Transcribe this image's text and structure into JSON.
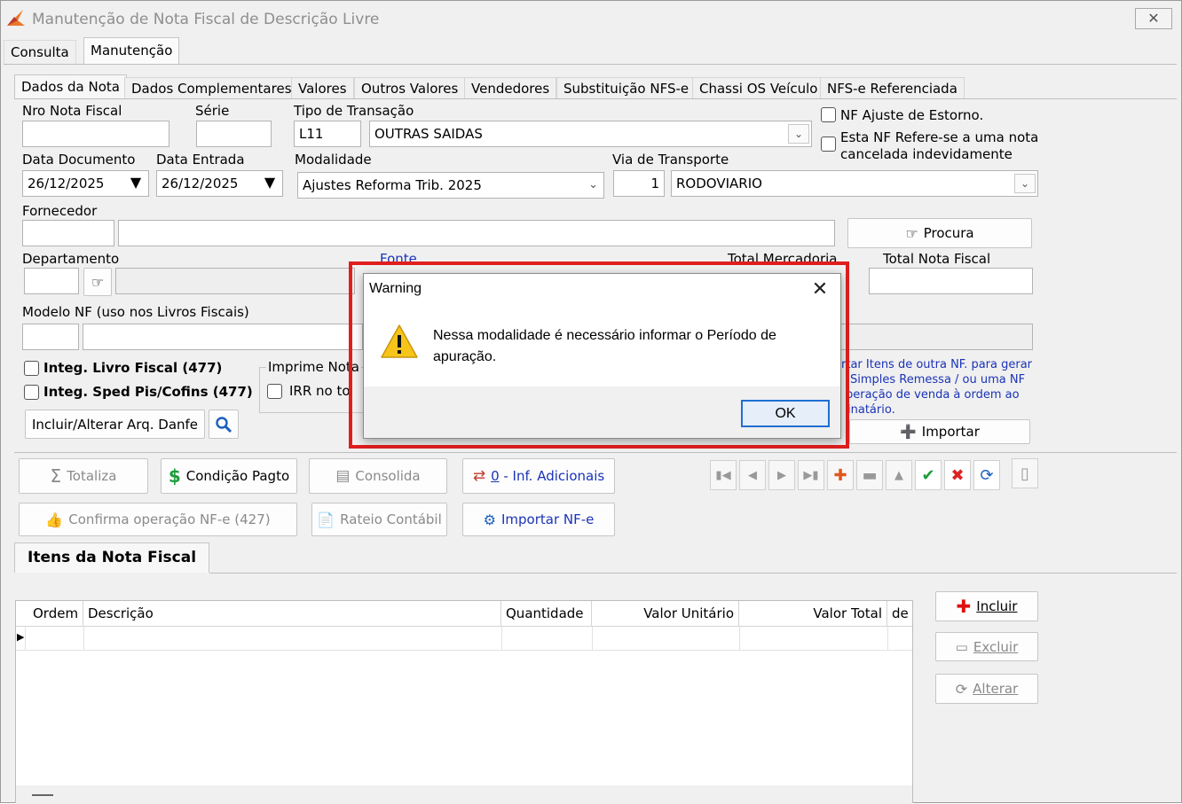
{
  "window": {
    "title": "Manutenção de Nota Fiscal de Descrição Livre",
    "close_glyph": "✕"
  },
  "main_tabs": [
    {
      "label": "Consulta"
    },
    {
      "label": "Manutenção"
    }
  ],
  "sub_tabs": [
    {
      "label": "Dados da Nota"
    },
    {
      "label": "Dados Complementares"
    },
    {
      "label": "Valores"
    },
    {
      "label": "Outros Valores"
    },
    {
      "label": "Vendedores"
    },
    {
      "label": "Substituição NFS-e"
    },
    {
      "label": "Chassi OS Veículo"
    },
    {
      "label": "NFS-e Referenciada"
    }
  ],
  "form": {
    "nro_nota_label": "Nro Nota Fiscal",
    "nro_nota_value": "",
    "serie_label": "Série",
    "serie_value": "",
    "tipo_transacao_label": "Tipo de Transação",
    "tipo_transacao_code": "L11",
    "tipo_transacao_value": "OUTRAS SAIDAS",
    "nf_ajuste_label": "NF Ajuste de Estorno.",
    "nf_refere_label_1": "Esta NF Refere-se a uma nota",
    "nf_refere_label_2": "cancelada indevidamente",
    "data_documento_label": "Data Documento",
    "data_documento_value": "26/12/2025",
    "data_entrada_label": "Data Entrada",
    "data_entrada_value": "26/12/2025",
    "modalidade_label": "Modalidade",
    "modalidade_value": "Ajustes Reforma Trib. 2025",
    "via_transporte_label": "Via de Transporte",
    "via_transporte_code": "1",
    "via_transporte_value": "RODOVIARIO",
    "fornecedor_label": "Fornecedor",
    "procura_label": "Procura",
    "departamento_label": "Departamento",
    "fonte_label": "Fonte",
    "total_mercadoria_label": "Total Mercadoria",
    "total_nota_label": "Total Nota Fiscal",
    "modelo_nf_label": "Modelo NF (uso nos Livros Fiscais)",
    "integ_livro_label": "Integ. Livro Fiscal (477)",
    "integ_sped_label": "Integ. Sped Pis/Cofins (477)",
    "imprime_nota_label": "Imprime Nota",
    "irr_label": "IRR no to",
    "incluir_danfe_label": "Incluir/Alterar Arq. Danfe",
    "importar_info_1": "rtar Itens de outra NF. para gerar",
    "importar_info_2": "Simples Remessa / ou uma NF",
    "importar_info_3": "peração de venda à ordem ao",
    "importar_info_4": "inatário.",
    "importar_label": "Importar"
  },
  "actions": {
    "totaliza": "Totaliza",
    "condicao_pagto": "Condição Pagto",
    "consolida": "Consolida",
    "inf_adicionais_num": "0",
    "inf_adicionais_text": " - Inf. Adicionais",
    "confirma_nfe": "Confirma operação NF-e (427)",
    "rateio": "Rateio Contábil",
    "importar_nfe": "Importar NF-e"
  },
  "items": {
    "title": "Itens da Nota Fiscal",
    "columns": [
      "Ordem",
      "Descrição",
      "Quantidade",
      "Valor Unitário",
      "Valor Total",
      "de"
    ],
    "incluir": "Incluir",
    "excluir": "Excluir",
    "alterar": "Alterar"
  },
  "dialog": {
    "title": "Warning",
    "message": "Nessa modalidade é necessário informar o Período de apuração.",
    "ok": "OK"
  },
  "colors": {
    "highlight_border": "#e01e1e",
    "link": "#1a33b8"
  }
}
